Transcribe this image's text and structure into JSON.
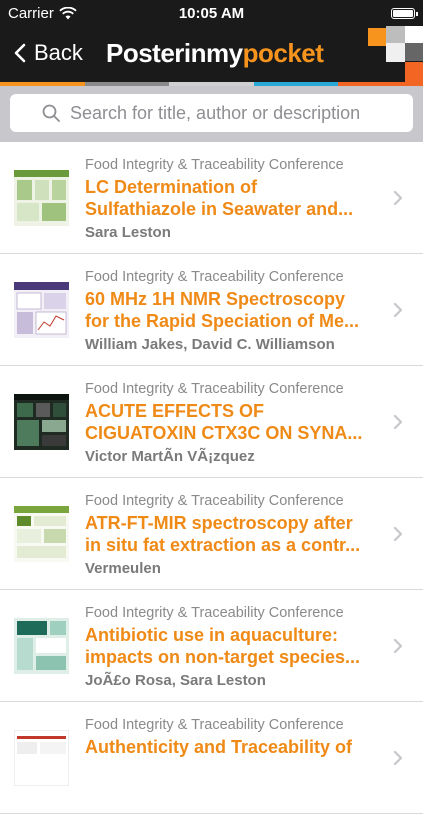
{
  "status": {
    "carrier": "Carrier",
    "time": "10:05 AM"
  },
  "nav": {
    "back_label": "Back",
    "logo_part1": "Posterinmy",
    "logo_part2": "pocket"
  },
  "search": {
    "placeholder": "Search for title, author or description"
  },
  "colors": {
    "accent": "#ef8a17",
    "header": "#1a1a1a"
  },
  "posters": [
    {
      "conference": "Food Integrity & Traceability Conference",
      "title_line1": " LC Determination of",
      "title_line2": "Sulfathiazole in Seawater and...",
      "authors": "Sara Leston",
      "thumb_theme": "green"
    },
    {
      "conference": "Food Integrity & Traceability Conference",
      "title_line1": "60 MHz 1H NMR Spectroscopy",
      "title_line2": "for the Rapid Speciation of Me...",
      "authors": "William Jakes, David C. Williamson",
      "thumb_theme": "purple"
    },
    {
      "conference": "Food Integrity & Traceability Conference",
      "title_line1": "ACUTE EFFECTS OF",
      "title_line2": "CIGUATOXIN CTX3C ON SYNA...",
      "authors": "Victor MartÃ­n VÃ¡zquez",
      "thumb_theme": "dark"
    },
    {
      "conference": "Food Integrity & Traceability Conference",
      "title_line1": "ATR-FT-MIR spectroscopy after",
      "title_line2": "in situ fat extraction as a contr...",
      "authors": "Vermeulen",
      "thumb_theme": "light-green"
    },
    {
      "conference": "Food Integrity & Traceability Conference",
      "title_line1": "Antibiotic use in aquaculture:",
      "title_line2": "impacts on non-target species...",
      "authors": "JoÃ£o Rosa, Sara Leston",
      "thumb_theme": "aqua"
    },
    {
      "conference": "Food Integrity & Traceability Conference",
      "title_line1": "Authenticity and Traceability of",
      "title_line2": "",
      "authors": "",
      "thumb_theme": "white"
    }
  ]
}
